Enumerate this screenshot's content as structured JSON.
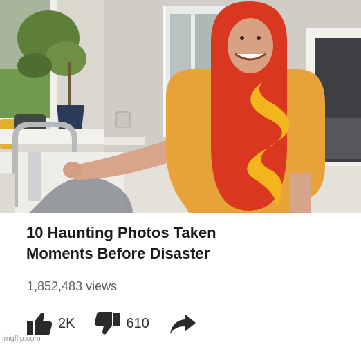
{
  "video": {
    "title_lines": [
      "10 Haunting Photos Taken",
      "Moments Before Disaster"
    ],
    "views": "1,852,483 views"
  },
  "actions": {
    "like_count": "2K",
    "dislike_count": "610"
  },
  "watermark": "imgflip.com",
  "colors": {
    "costume_bun": "#e8a23a",
    "costume_sausage": "#d9371f",
    "mustard": "#f2b51e",
    "icon": "#2a2a2a"
  }
}
